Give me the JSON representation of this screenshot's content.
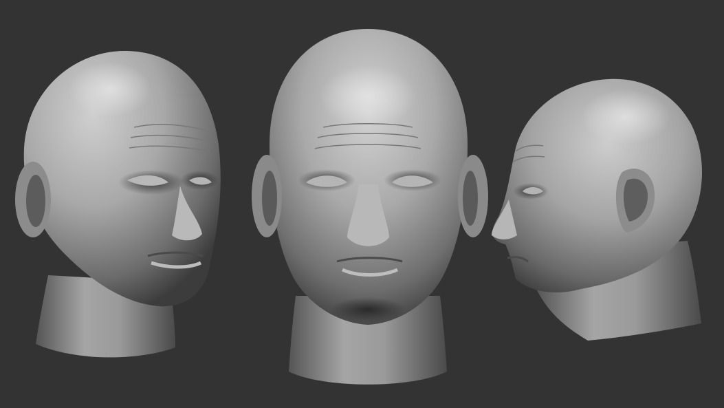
{
  "scene": {
    "background_color": "#333333",
    "clay_light": "#d4d4d4",
    "clay_mid": "#9a9a9a",
    "clay_dark": "#2e2e2e",
    "views": [
      {
        "view": "three-quarter"
      },
      {
        "view": "front"
      },
      {
        "view": "profile"
      }
    ]
  }
}
